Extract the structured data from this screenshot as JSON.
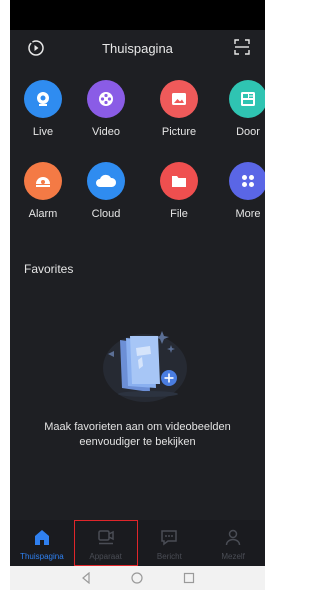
{
  "header": {
    "title": "Thuispagina"
  },
  "apps": [
    {
      "label": "Live",
      "color": "#2f8cf0",
      "icon": "camera-icon"
    },
    {
      "label": "Video",
      "color": "#8a5ce6",
      "icon": "film-reel-icon"
    },
    {
      "label": "Picture",
      "color": "#ef5a5a",
      "icon": "picture-icon"
    },
    {
      "label": "Door",
      "color": "#2fc4b2",
      "icon": "door-panel-icon"
    },
    {
      "label": "Alarm",
      "color": "#f47a45",
      "icon": "alarm-icon"
    },
    {
      "label": "Cloud",
      "color": "#2f8cf0",
      "icon": "cloud-icon"
    },
    {
      "label": "File",
      "color": "#ef4f4f",
      "icon": "folder-icon"
    },
    {
      "label": "More",
      "color": "#5a66e6",
      "icon": "more-grid-icon"
    }
  ],
  "favorites": {
    "title": "Favorites",
    "empty_line1": "Maak favorieten aan om videobeelden",
    "empty_line2": "eenvoudiger te bekijken"
  },
  "tabs": [
    {
      "label": "Thuispagina",
      "active": true
    },
    {
      "label": "Apparaat",
      "active": false
    },
    {
      "label": "Bericht",
      "active": false
    },
    {
      "label": "Mezelf",
      "active": false
    }
  ],
  "colors": {
    "accent": "#2f80f0",
    "highlight": "#e0262b",
    "background": "#1e1f23"
  }
}
